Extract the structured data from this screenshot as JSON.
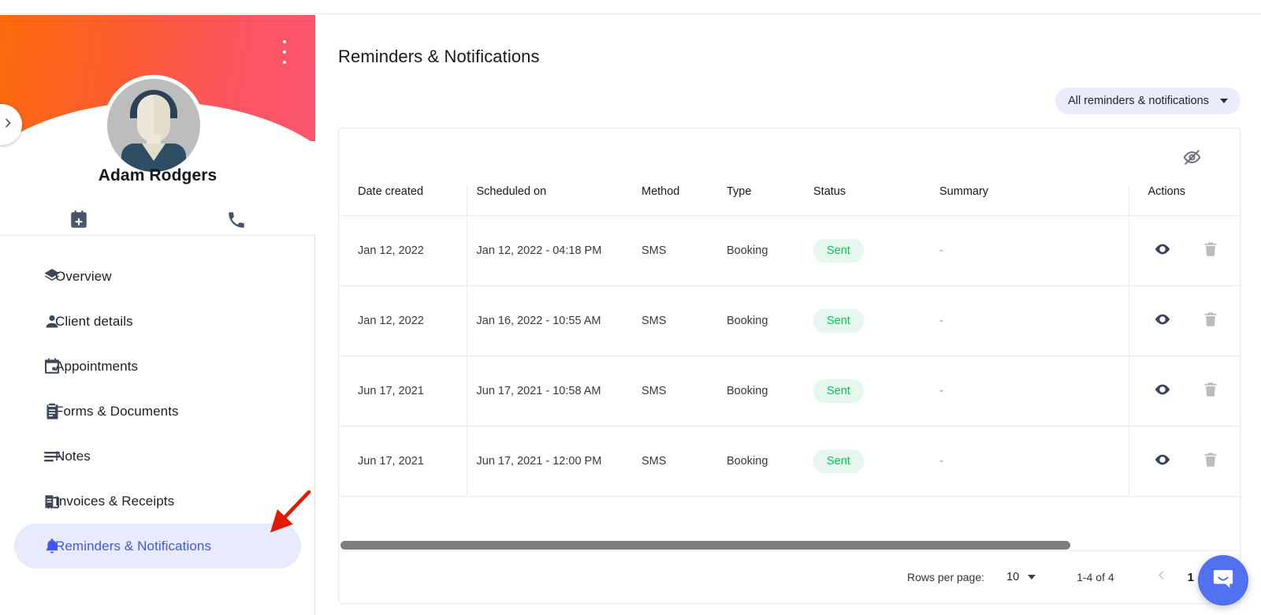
{
  "profile": {
    "name": "Adam Rodgers",
    "menu_icon": "kebab-menu-icon",
    "collapse_icon": "chevron-right-icon",
    "avatar_icon": "user-avatar-placeholder",
    "actions": [
      {
        "icon": "calendar-add-icon",
        "name": "new-appointment"
      },
      {
        "icon": "phone-icon",
        "name": "call-client"
      }
    ]
  },
  "sidebar": {
    "items": [
      {
        "label": "Overview",
        "icon": "layers-icon",
        "active": false
      },
      {
        "label": "Client details",
        "icon": "person-icon",
        "active": false
      },
      {
        "label": "Appointments",
        "icon": "calendar-icon",
        "active": false
      },
      {
        "label": "Forms & Documents",
        "icon": "clipboard-icon",
        "active": false
      },
      {
        "label": "Notes",
        "icon": "notes-lines-icon",
        "active": false
      },
      {
        "label": "Invoices & Receipts",
        "icon": "receipt-icon",
        "active": false
      },
      {
        "label": "Reminders & Notifications",
        "icon": "bell-icon",
        "active": true
      }
    ]
  },
  "main": {
    "title": "Reminders & Notifications",
    "filter": {
      "label": "All reminders & notifications",
      "caret_icon": "chevron-down-icon"
    },
    "hide_columns_icon": "eye-off-icon",
    "columns": [
      "Date created",
      "Scheduled on",
      "Method",
      "Type",
      "Status",
      "Summary",
      "Actions"
    ],
    "rows": [
      {
        "date_created": "Jan 12, 2022",
        "scheduled_on": "Jan 12, 2022 - 04:18 PM",
        "method": "SMS",
        "type": "Booking",
        "status": "Sent",
        "summary": "-",
        "actions": [
          "eye-icon",
          "trash-icon"
        ]
      },
      {
        "date_created": "Jan 12, 2022",
        "scheduled_on": "Jan 16, 2022 - 10:55 AM",
        "method": "SMS",
        "type": "Booking",
        "status": "Sent",
        "summary": "-",
        "actions": [
          "eye-icon",
          "trash-icon"
        ]
      },
      {
        "date_created": "Jun 17, 2021",
        "scheduled_on": "Jun 17, 2021 - 10:58 AM",
        "method": "SMS",
        "type": "Booking",
        "status": "Sent",
        "summary": "-",
        "actions": [
          "eye-icon",
          "trash-icon"
        ]
      },
      {
        "date_created": "Jun 17, 2021",
        "scheduled_on": "Jun 17, 2021 - 12:00 PM",
        "method": "SMS",
        "type": "Booking",
        "status": "Sent",
        "summary": "-",
        "actions": [
          "eye-icon",
          "trash-icon"
        ]
      }
    ],
    "pagination": {
      "rows_per_page_label": "Rows per page:",
      "rows_per_page_value": "10",
      "range": "1-4 of 4",
      "prev_icon": "chevron-left-icon",
      "current_page": "1"
    }
  },
  "chat_widget": {
    "icon": "intercom-chat-icon"
  },
  "annotation": {
    "type": "arrow",
    "color": "#e01b00",
    "points_to": "Reminders & Notifications"
  },
  "colors": {
    "banner_start": "#FC6A0A",
    "banner_end": "#FB5570",
    "accent_blue": "#4355f0",
    "active_bg": "#e8eafd",
    "status_green": "#03c752",
    "status_green_bg": "#e6f8ed",
    "chip_bg": "#eaecfb",
    "chat_blue": "#5271ef"
  }
}
